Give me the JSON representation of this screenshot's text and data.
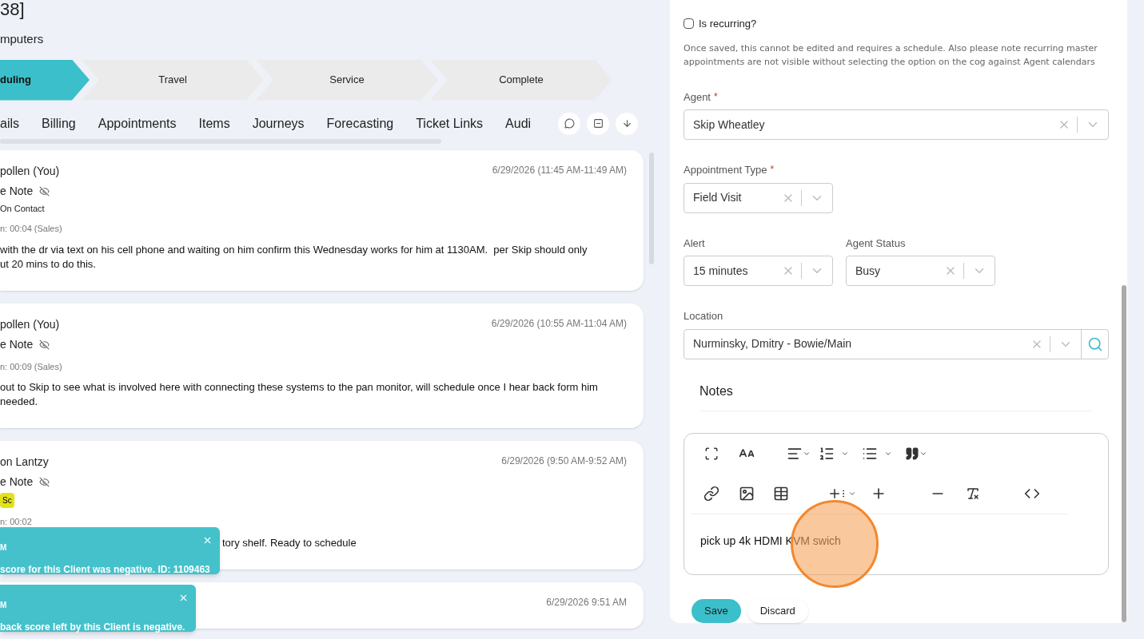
{
  "header": {
    "title": "38]",
    "subtitle": "mputers"
  },
  "steps": [
    {
      "label": "duling",
      "selected": true
    },
    {
      "label": "Travel",
      "selected": false
    },
    {
      "label": "Service",
      "selected": false
    },
    {
      "label": "Complete",
      "selected": false
    }
  ],
  "tabs": [
    {
      "label": "ails",
      "selected": false
    },
    {
      "label": "Billing",
      "selected": false
    },
    {
      "label": "Appointments",
      "selected": false
    },
    {
      "label": "Items",
      "selected": false
    },
    {
      "label": "Journeys",
      "selected": false
    },
    {
      "label": "Forecasting",
      "selected": false
    },
    {
      "label": "Ticket Links",
      "selected": false
    },
    {
      "label": "Audi",
      "selected": false
    }
  ],
  "notes": [
    {
      "author": "pollen (You)",
      "type": "e Note",
      "tag": "On Contact",
      "duration": "n: 00:04 (Sales)",
      "date": "6/29/2026 (11:45 AM-11:49 AM)",
      "body": "with the dr via text on his cell phone and waiting on him confirm this Wednesday works for him at 1130AM.  per Skip should only\nut 20 mins to do this."
    },
    {
      "author": "pollen (You)",
      "type": "e Note",
      "duration": "n: 00:09 (Sales)",
      "date": "6/29/2026 (10:55 AM-11:04 AM)",
      "body": "out to Skip to see what is involved here with connecting these systems to the pan monitor, will schedule once I hear back form him\nneeded."
    },
    {
      "author": "on Lantzy",
      "type": "e Note",
      "badge": "Sc",
      "duration": "n: 00:02",
      "date": "6/29/2026 (9:50 AM-9:52 AM)",
      "body": "tory shelf. Ready to schedule"
    },
    {
      "date": "6/29/2026 9:51 AM"
    }
  ],
  "toasts": [
    {
      "title": "M",
      "message": "score for this Client was negative. ID: 1109463"
    },
    {
      "title": "M",
      "message": "back score left by this Client is negative."
    }
  ],
  "form": {
    "recurring": {
      "label": "Is recurring?",
      "checked": false
    },
    "recurring_note": "Once saved, this cannot be edited and requires a schedule. Also please note recurring master appointments are not visible without selecting the option on the cog against Agent calendars",
    "required_mark": "*",
    "fields": [
      {
        "label": "Agent",
        "required": true,
        "value": "Skip Wheatley",
        "kind": "wide"
      },
      {
        "label": "Appointment Type",
        "required": true,
        "value": "Field Visit",
        "kind": "narrow"
      },
      {
        "label": "Alert",
        "required": false,
        "value": "15 minutes",
        "kind": "pair"
      },
      {
        "label": "Agent Status",
        "required": false,
        "value": "Busy",
        "kind": "pair"
      },
      {
        "label": "Location",
        "required": false,
        "value": "Nurminsky, Dmitry - Bowie/Main",
        "kind": "search"
      }
    ],
    "notes_title": "Notes",
    "notes_text": "pick up 4k HDMI KVM swich",
    "buttons": [
      {
        "label": "Save",
        "kind": "primary"
      },
      {
        "label": "Discard",
        "kind": "secondary"
      }
    ]
  }
}
